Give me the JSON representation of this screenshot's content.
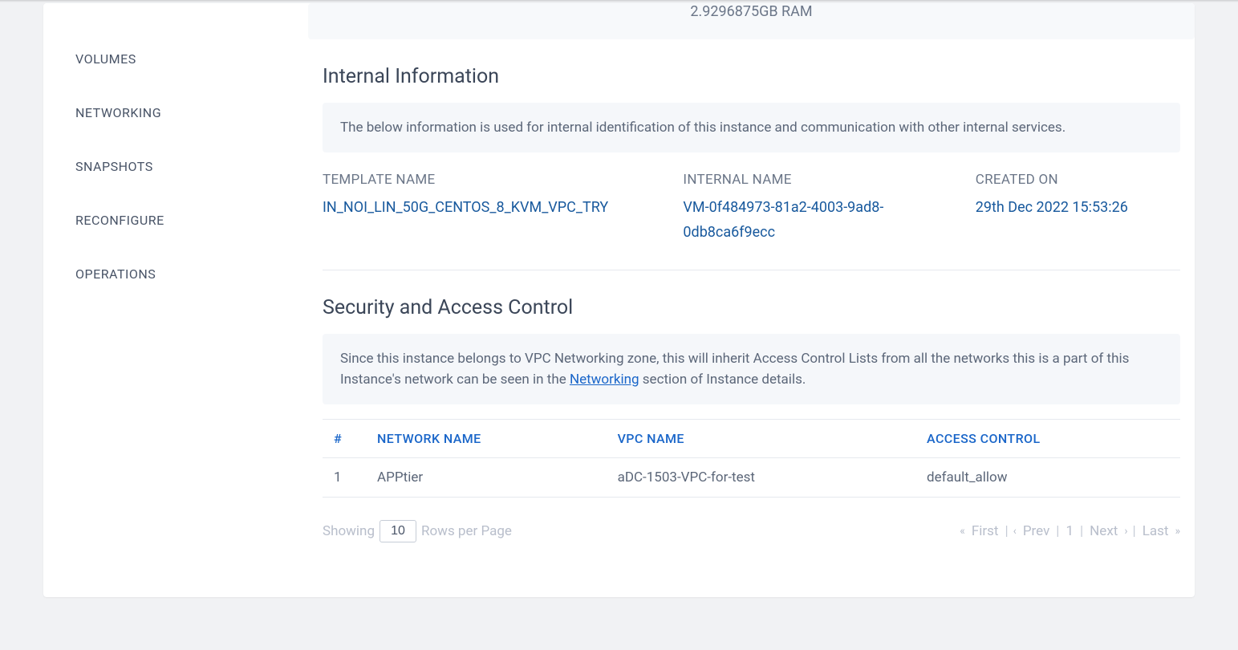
{
  "sidebar": {
    "items": [
      {
        "label": "VOLUMES"
      },
      {
        "label": "NETWORKING"
      },
      {
        "label": "SNAPSHOTS"
      },
      {
        "label": "RECONFIGURE"
      },
      {
        "label": "OPERATIONS"
      }
    ]
  },
  "header_box": {
    "ram": "2.9296875GB RAM"
  },
  "internal": {
    "title": "Internal Information",
    "banner": "The below information is used for internal identification of this instance and communication with other internal services.",
    "template_label": "TEMPLATE NAME",
    "template_value": "IN_NOI_LIN_50G_CENTOS_8_KVM_VPC_TRY",
    "internal_label": "INTERNAL NAME",
    "internal_value": "VM-0f484973-81a2-4003-9ad8-0db8ca6f9ecc",
    "created_label": "CREATED ON",
    "created_value": "29th Dec 2022 15:53:26"
  },
  "security": {
    "title": "Security and Access Control",
    "banner_before": "Since this instance belongs to VPC Networking zone, this will inherit Access Control Lists from all the networks this is a part of this Instance's network can be seen in the ",
    "banner_link": "Networking",
    "banner_after": " section of Instance details.",
    "columns": {
      "hash": "#",
      "network": "NETWORK NAME",
      "vpc": "VPC NAME",
      "access": "ACCESS CONTROL"
    },
    "rows": [
      {
        "idx": "1",
        "network": "APPtier",
        "vpc": "aDC-1503-VPC-for-test",
        "access": "default_allow"
      }
    ]
  },
  "pager": {
    "showing": "Showing",
    "rows_value": "10",
    "rows_label": "Rows per Page",
    "first": "First",
    "prev": "Prev",
    "page": "1",
    "next": "Next",
    "last": "Last"
  }
}
